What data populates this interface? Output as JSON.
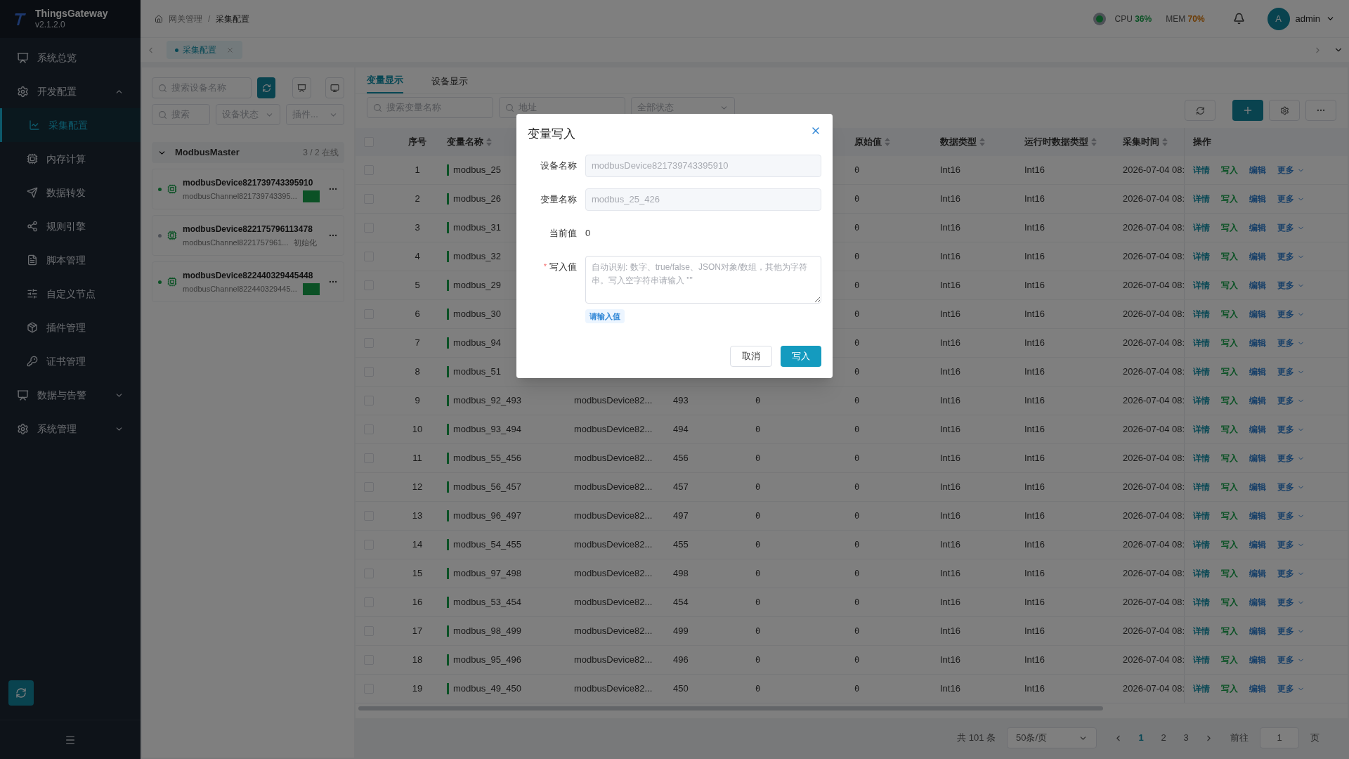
{
  "app": {
    "name": "ThingsGateway",
    "version": "v2.1.2.0"
  },
  "breadcrumb": [
    "网关管理",
    "采集配置"
  ],
  "breadcrumb_separator": "/",
  "status": {
    "cpu_label": "CPU",
    "cpu": "36%",
    "mem_label": "MEM",
    "mem": "70%"
  },
  "user": {
    "avatar": "A",
    "name": "admin"
  },
  "page_tabs": [
    {
      "label": "采集配置",
      "selected": true
    }
  ],
  "sidebar": {
    "items": [
      {
        "kind": "link",
        "label": "系统总览"
      },
      {
        "kind": "group",
        "label": "开发配置",
        "expanded": true,
        "children": [
          {
            "label": "采集配置",
            "selected": true
          },
          {
            "label": "内存计算",
            "selected": false
          },
          {
            "label": "数据转发",
            "selected": false
          },
          {
            "label": "规则引擎",
            "selected": false
          },
          {
            "label": "脚本管理",
            "selected": false
          },
          {
            "label": "自定义节点",
            "selected": false
          },
          {
            "label": "插件管理",
            "selected": false
          },
          {
            "label": "证书管理",
            "selected": false
          }
        ]
      },
      {
        "kind": "group",
        "label": "数据与告警",
        "expanded": false
      },
      {
        "kind": "group",
        "label": "系统管理",
        "expanded": false
      }
    ]
  },
  "device_panel": {
    "search_placeholder": "搜索设备名称",
    "filter_placeholder": "搜索",
    "status_select": "设备状态",
    "plugin_select": "插件...",
    "group": {
      "name": "ModbusMaster",
      "count": "3 / 2 在线",
      "expanded": true,
      "devices": [
        {
          "name": "modbusDevice821739743395910",
          "channel": "modbusChannel821739743395...",
          "online": true,
          "kind": "square"
        },
        {
          "name": "modbusDevice822175796113478",
          "channel": "modbusChannel8221757961...",
          "online": false,
          "kind": "text",
          "status": "初始化"
        },
        {
          "name": "modbusDevice822440329445448",
          "channel": "modbusChannel822440329445...",
          "online": true,
          "kind": "square"
        }
      ]
    }
  },
  "view_tabs": [
    {
      "label": "变量显示",
      "selected": true
    },
    {
      "label": "设备显示",
      "selected": false
    }
  ],
  "filters": {
    "name_placeholder": "搜索变量名称",
    "address_placeholder": "地址",
    "state_select": "全部状态"
  },
  "table": {
    "header_checked": false,
    "columns": [
      {
        "label": "序号",
        "sortable": false
      },
      {
        "label": "变量名称",
        "sortable": true
      },
      {
        "label": "原始值",
        "sortable": true
      },
      {
        "label": "数据类型",
        "sortable": true
      },
      {
        "label": "运行时数据类型",
        "sortable": true
      },
      {
        "label": "采集时间",
        "sortable": true
      },
      {
        "label": "操作",
        "sortable": false
      }
    ],
    "rows": [
      {
        "checked": false,
        "no": "1",
        "name": "modbus_25",
        "raw": "0",
        "type": "Int16",
        "runtime_type": "Int16",
        "time": "2026-07-04 08:",
        "actions": [
          "详情",
          "写入",
          "编辑",
          "更多"
        ]
      },
      {
        "checked": false,
        "no": "2",
        "name": "modbus_26",
        "raw": "0",
        "type": "Int16",
        "runtime_type": "Int16",
        "time": "2026-07-04 08:",
        "actions": [
          "详情",
          "写入",
          "编辑",
          "更多"
        ]
      },
      {
        "checked": false,
        "no": "3",
        "name": "modbus_31",
        "raw": "0",
        "type": "Int16",
        "runtime_type": "Int16",
        "time": "2026-07-04 08:",
        "actions": [
          "详情",
          "写入",
          "编辑",
          "更多"
        ]
      },
      {
        "checked": false,
        "no": "4",
        "name": "modbus_32",
        "raw": "0",
        "type": "Int16",
        "runtime_type": "Int16",
        "time": "2026-07-04 08:",
        "actions": [
          "详情",
          "写入",
          "编辑",
          "更多"
        ]
      },
      {
        "checked": false,
        "no": "5",
        "name": "modbus_29",
        "raw": "0",
        "type": "Int16",
        "runtime_type": "Int16",
        "time": "2026-07-04 08:",
        "actions": [
          "详情",
          "写入",
          "编辑",
          "更多"
        ]
      },
      {
        "checked": false,
        "no": "6",
        "name": "modbus_30",
        "raw": "0",
        "type": "Int16",
        "runtime_type": "Int16",
        "time": "2026-07-04 08:",
        "actions": [
          "详情",
          "写入",
          "编辑",
          "更多"
        ]
      },
      {
        "checked": false,
        "no": "7",
        "name": "modbus_94",
        "raw": "0",
        "type": "Int16",
        "runtime_type": "Int16",
        "time": "2026-07-04 08:",
        "actions": [
          "详情",
          "写入",
          "编辑",
          "更多"
        ]
      },
      {
        "checked": false,
        "no": "8",
        "name": "modbus_51",
        "raw": "0",
        "type": "Int16",
        "runtime_type": "Int16",
        "time": "2026-07-04 08:",
        "actions": [
          "详情",
          "写入",
          "编辑",
          "更多"
        ]
      },
      {
        "checked": false,
        "no": "9",
        "name": "modbus_92_493",
        "device": "modbusDevice82...",
        "address": "493",
        "value": "0",
        "raw": "0",
        "type": "Int16",
        "runtime_type": "Int16",
        "time": "2026-07-04 08:",
        "actions": [
          "详情",
          "写入",
          "编辑",
          "更多"
        ]
      },
      {
        "checked": false,
        "no": "10",
        "name": "modbus_93_494",
        "device": "modbusDevice82...",
        "address": "494",
        "value": "0",
        "raw": "0",
        "type": "Int16",
        "runtime_type": "Int16",
        "time": "2026-07-04 08:",
        "actions": [
          "详情",
          "写入",
          "编辑",
          "更多"
        ]
      },
      {
        "checked": false,
        "no": "11",
        "name": "modbus_55_456",
        "device": "modbusDevice82...",
        "address": "456",
        "value": "0",
        "raw": "0",
        "type": "Int16",
        "runtime_type": "Int16",
        "time": "2026-07-04 08:",
        "actions": [
          "详情",
          "写入",
          "编辑",
          "更多"
        ]
      },
      {
        "checked": false,
        "no": "12",
        "name": "modbus_56_457",
        "device": "modbusDevice82...",
        "address": "457",
        "value": "0",
        "raw": "0",
        "type": "Int16",
        "runtime_type": "Int16",
        "time": "2026-07-04 08:",
        "actions": [
          "详情",
          "写入",
          "编辑",
          "更多"
        ]
      },
      {
        "checked": false,
        "no": "13",
        "name": "modbus_96_497",
        "device": "modbusDevice82...",
        "address": "497",
        "value": "0",
        "raw": "0",
        "type": "Int16",
        "runtime_type": "Int16",
        "time": "2026-07-04 08:",
        "actions": [
          "详情",
          "写入",
          "编辑",
          "更多"
        ]
      },
      {
        "checked": false,
        "no": "14",
        "name": "modbus_54_455",
        "device": "modbusDevice82...",
        "address": "455",
        "value": "0",
        "raw": "0",
        "type": "Int16",
        "runtime_type": "Int16",
        "time": "2026-07-04 08:",
        "actions": [
          "详情",
          "写入",
          "编辑",
          "更多"
        ]
      },
      {
        "checked": false,
        "no": "15",
        "name": "modbus_97_498",
        "device": "modbusDevice82...",
        "address": "498",
        "value": "0",
        "raw": "0",
        "type": "Int16",
        "runtime_type": "Int16",
        "time": "2026-07-04 08:",
        "actions": [
          "详情",
          "写入",
          "编辑",
          "更多"
        ]
      },
      {
        "checked": false,
        "no": "16",
        "name": "modbus_53_454",
        "device": "modbusDevice82...",
        "address": "454",
        "value": "0",
        "raw": "0",
        "type": "Int16",
        "runtime_type": "Int16",
        "time": "2026-07-04 08:",
        "actions": [
          "详情",
          "写入",
          "编辑",
          "更多"
        ]
      },
      {
        "checked": false,
        "no": "17",
        "name": "modbus_98_499",
        "device": "modbusDevice82...",
        "address": "499",
        "value": "0",
        "raw": "0",
        "type": "Int16",
        "runtime_type": "Int16",
        "time": "2026-07-04 08:",
        "actions": [
          "详情",
          "写入",
          "编辑",
          "更多"
        ]
      },
      {
        "checked": false,
        "no": "18",
        "name": "modbus_95_496",
        "device": "modbusDevice82...",
        "address": "496",
        "value": "0",
        "raw": "0",
        "type": "Int16",
        "runtime_type": "Int16",
        "time": "2026-07-04 08:",
        "actions": [
          "详情",
          "写入",
          "编辑",
          "更多"
        ]
      },
      {
        "checked": false,
        "no": "19",
        "name": "modbus_49_450",
        "device": "modbusDevice82...",
        "address": "450",
        "value": "0",
        "raw": "0",
        "type": "Int16",
        "runtime_type": "Int16",
        "time": "2026-07-04 08:",
        "actions": [
          "详情",
          "写入",
          "编辑",
          "更多"
        ]
      }
    ]
  },
  "pagination": {
    "total": "共 101 条",
    "page_size": "50条/页",
    "pages": [
      {
        "label": "1",
        "selected": true
      },
      {
        "label": "2",
        "selected": false
      },
      {
        "label": "3",
        "selected": false
      }
    ],
    "goto_label": "前往",
    "goto_value": "1",
    "goto_suffix": "页"
  },
  "modal": {
    "title": "变量写入",
    "required_mark": "*",
    "fields": [
      {
        "kind": "input",
        "label": "设备名称",
        "value": "modbusDevice821739743395910",
        "disabled": true,
        "required": false
      },
      {
        "kind": "input",
        "label": "变量名称",
        "value": "modbus_25_426",
        "disabled": true,
        "required": false
      },
      {
        "kind": "text",
        "label": "当前值",
        "value": "0",
        "required": false
      },
      {
        "kind": "textarea",
        "label": "写入值",
        "required": true,
        "placeholder": "自动识别: 数字、true/false、JSON对象/数组，其他为字符串。写入空字符串请输入 \"\"",
        "hint": "请输入值"
      }
    ],
    "buttons": [
      {
        "label": "取消",
        "kind": "secondary"
      },
      {
        "label": "写入",
        "kind": "primary"
      }
    ]
  }
}
